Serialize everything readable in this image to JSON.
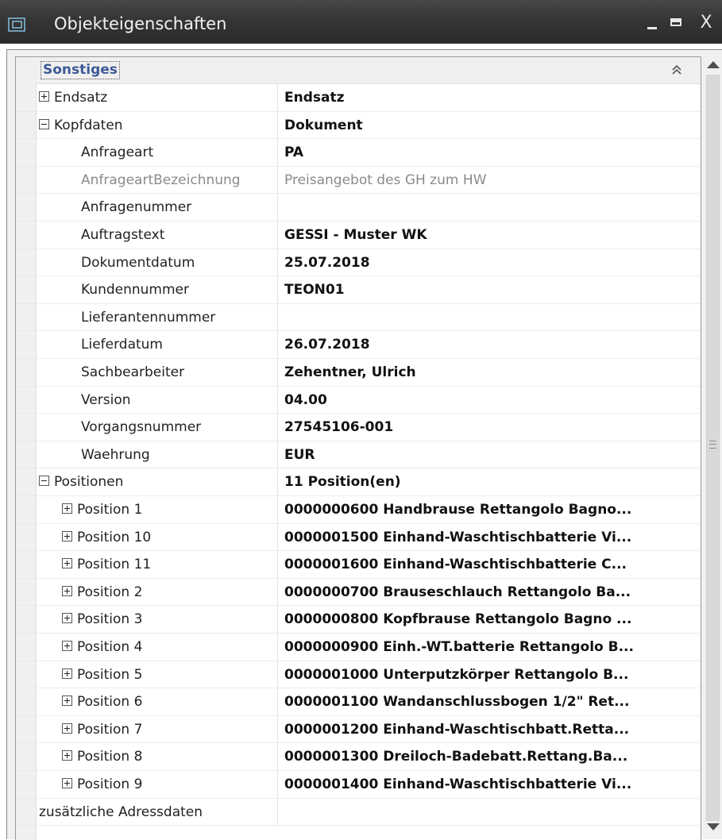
{
  "window": {
    "title": "Objekteigenschaften",
    "icon": "window-restore-icon",
    "close_glyph": "X"
  },
  "category": {
    "label": "Sonstiges",
    "collapse_glyph": "«"
  },
  "rows": [
    {
      "name": "Endsatz",
      "value": "Endsatz",
      "level": 0,
      "expander": "plus",
      "bold": true
    },
    {
      "name": "Kopfdaten",
      "value": "Dokument",
      "level": 0,
      "expander": "minus",
      "bold": true
    },
    {
      "name": "Anfrageart",
      "value": "PA",
      "level": 1,
      "bold": true
    },
    {
      "name": "AnfrageartBezeichnung",
      "value": "Preisangebot des GH zum HW",
      "level": 1,
      "dim": true
    },
    {
      "name": "Anfragenummer",
      "value": "",
      "level": 1
    },
    {
      "name": "Auftragstext",
      "value": "GESSI - Muster WK",
      "level": 1,
      "bold": true
    },
    {
      "name": "Dokumentdatum",
      "value": "25.07.2018",
      "level": 1,
      "bold": true
    },
    {
      "name": "Kundennummer",
      "value": "TEON01",
      "level": 1,
      "bold": true
    },
    {
      "name": "Lieferantennummer",
      "value": "",
      "level": 1
    },
    {
      "name": "Lieferdatum",
      "value": "26.07.2018",
      "level": 1,
      "bold": true
    },
    {
      "name": "Sachbearbeiter",
      "value": "Zehentner, Ulrich",
      "level": 1,
      "bold": true
    },
    {
      "name": "Version",
      "value": "04.00",
      "level": 1,
      "bold": true
    },
    {
      "name": "Vorgangsnummer",
      "value": "27545106-001",
      "level": 1,
      "bold": true
    },
    {
      "name": "Waehrung",
      "value": "EUR",
      "level": 1,
      "bold": true
    },
    {
      "name": "Positionen",
      "value": "11 Position(en)",
      "level": 0,
      "expander": "minus",
      "bold": true
    },
    {
      "name": "Position 1",
      "value": "0000000600 Handbrause Rettangolo Bagno...",
      "level": 1,
      "expander": "plus",
      "bold": true
    },
    {
      "name": "Position 10",
      "value": "0000001500 Einhand-Waschtischbatterie Vi...",
      "level": 1,
      "expander": "plus",
      "bold": true
    },
    {
      "name": "Position 11",
      "value": "0000001600 Einhand-Waschtischbatterie C...",
      "level": 1,
      "expander": "plus",
      "bold": true
    },
    {
      "name": "Position 2",
      "value": "0000000700 Brauseschlauch Rettangolo Ba...",
      "level": 1,
      "expander": "plus",
      "bold": true
    },
    {
      "name": "Position 3",
      "value": "0000000800 Kopfbrause Rettangolo Bagno ...",
      "level": 1,
      "expander": "plus",
      "bold": true
    },
    {
      "name": "Position 4",
      "value": "0000000900 Einh.-WT.batterie Rettangolo B...",
      "level": 1,
      "expander": "plus",
      "bold": true
    },
    {
      "name": "Position 5",
      "value": "0000001000 Unterputzkörper Rettangolo B...",
      "level": 1,
      "expander": "plus",
      "bold": true
    },
    {
      "name": "Position 6",
      "value": "0000001100 Wandanschlussbogen 1/2\" Ret...",
      "level": 1,
      "expander": "plus",
      "bold": true
    },
    {
      "name": "Position 7",
      "value": "0000001200 Einhand-Waschtischbatt.Retta...",
      "level": 1,
      "expander": "plus",
      "bold": true
    },
    {
      "name": "Position 8",
      "value": "0000001300 Dreiloch-Badebatt.Rettang.Ba...",
      "level": 1,
      "expander": "plus",
      "bold": true
    },
    {
      "name": "Position 9",
      "value": "0000001400 Einhand-Waschtischbatterie Vi...",
      "level": 1,
      "expander": "plus",
      "bold": true
    },
    {
      "name": "zusätzliche Adressdaten",
      "value": "",
      "level": 0
    }
  ]
}
